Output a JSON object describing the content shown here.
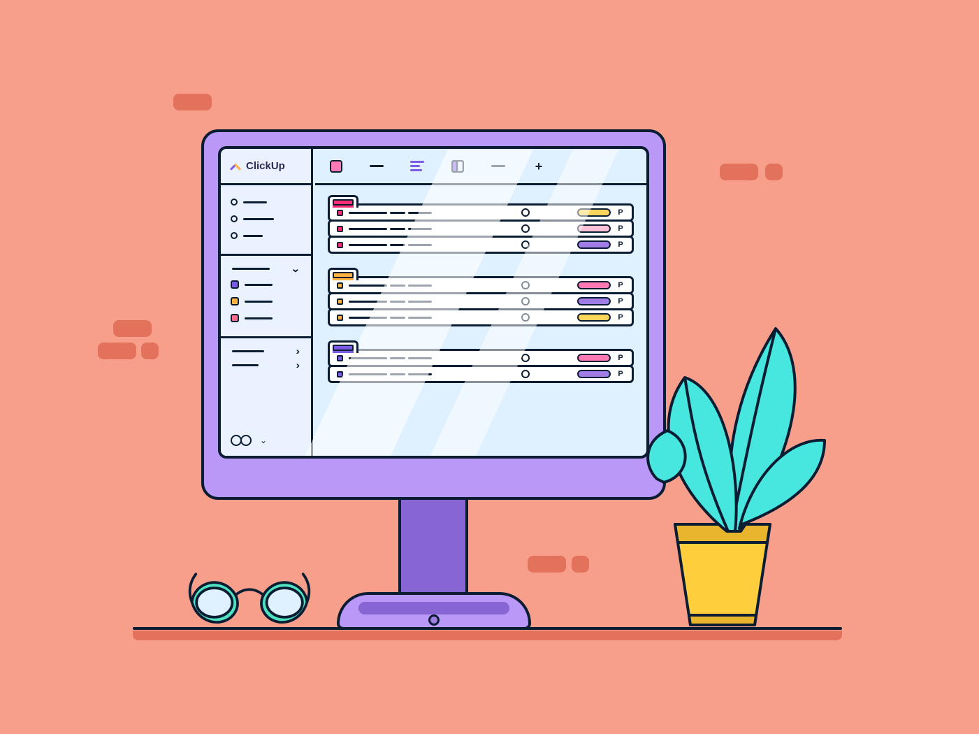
{
  "app": {
    "name": "ClickUp"
  },
  "sidebar": {
    "nav_items": [
      {},
      {},
      {}
    ],
    "spaces": [
      {
        "color": "#7c5ce6"
      },
      {
        "color": "#ffb341"
      },
      {
        "color": "#ff6b8a"
      }
    ],
    "folders": [
      {},
      {}
    ]
  },
  "toolbar": {
    "list_view_color": "#ff7ab2",
    "board_icon_color": "#7c5ce6"
  },
  "priority_glyph": "P",
  "groups": [
    {
      "tab_color": "#ff2e74",
      "tasks": [
        {
          "square": "#ff2e74",
          "tag": "#ffd55a"
        },
        {
          "square": "#ff2e74",
          "tag": "#ffc1d6"
        },
        {
          "square": "#ff2e74",
          "tag": "#a07de6"
        }
      ]
    },
    {
      "tab_color": "#ffb341",
      "tasks": [
        {
          "square": "#ffb341",
          "tag": "#ff7ab2"
        },
        {
          "square": "#ffb341",
          "tag": "#a07de6"
        },
        {
          "square": "#ffb341",
          "tag": "#ffd55a"
        }
      ]
    },
    {
      "tab_color": "#7c5ce6",
      "tasks": [
        {
          "square": "#7c5ce6",
          "tag": "#ff7ab2"
        },
        {
          "square": "#7c5ce6",
          "tag": "#a07de6"
        }
      ]
    }
  ],
  "scene": {
    "bg": "#f79f8b",
    "brick": "#e2725b",
    "monitor": "#b998f8",
    "monitor_dark": "#8765d3",
    "screen_bg": "#dff1ff",
    "sidebar_bg": "#eaf2ff",
    "pot": "#ffce3d",
    "leaf": "#47e6df",
    "leaf_dark": "#17b6ae",
    "glasses": "#4fe3c1"
  }
}
